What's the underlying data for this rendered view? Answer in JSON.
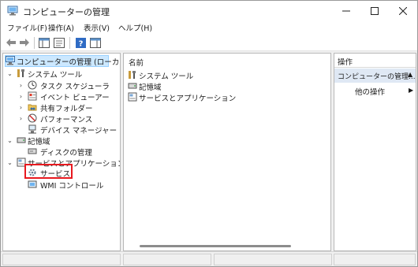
{
  "window": {
    "title": "コンピューターの管理",
    "minimize_icon": "minimize-icon",
    "maximize_icon": "maximize-icon",
    "close_icon": "close-icon"
  },
  "menu": {
    "file": "ファイル(F)",
    "action": "操作(A)",
    "view": "表示(V)",
    "help": "ヘルプ(H)"
  },
  "toolbar": {
    "icons": [
      "back-arrow-icon",
      "forward-arrow-icon",
      "show-hide-tree-icon",
      "properties-icon",
      "help-icon",
      "show-hide-action-pane-icon"
    ]
  },
  "tree": {
    "root": "コンピューターの管理 (ローカル)",
    "system_tools": "システム ツール",
    "task_scheduler": "タスク スケジューラ",
    "event_viewer": "イベント ビューアー",
    "shared_folders": "共有フォルダー",
    "performance": "パフォーマンス",
    "device_manager": "デバイス マネージャー",
    "storage": "記憶域",
    "disk_management": "ディスクの管理",
    "services_apps": "サービスとアプリケーション",
    "services": "サービス",
    "wmi_control": "WMI コントロール"
  },
  "list": {
    "column_name": "名前",
    "items": [
      "システム ツール",
      "記憶域",
      "サービスとアプリケーション"
    ]
  },
  "actions": {
    "header": "操作",
    "section": "コンピューターの管理...",
    "other": "他の操作"
  },
  "colors": {
    "highlight_box": "#e8191f",
    "selected_bg": "#cce8ff",
    "action_section_bg": "#dfe8f4"
  }
}
